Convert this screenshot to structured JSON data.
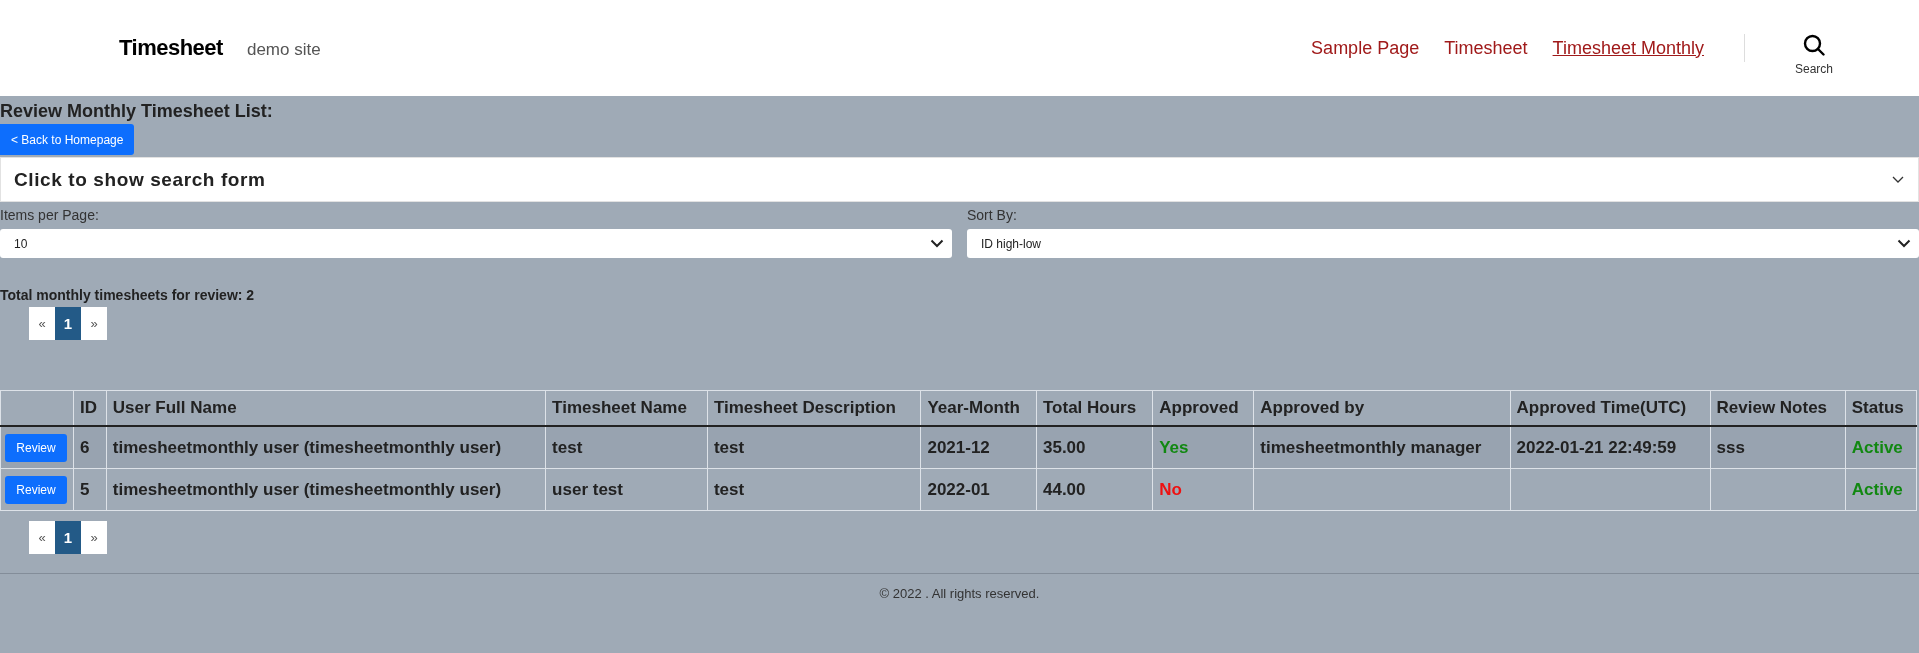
{
  "header": {
    "site_title": "Timesheet",
    "tagline": "demo site",
    "nav": [
      {
        "label": "Sample Page",
        "selected": false
      },
      {
        "label": "Timesheet",
        "selected": false
      },
      {
        "label": "Timesheet Monthly",
        "selected": true
      }
    ],
    "search_label": "Search"
  },
  "page_title": "Review Monthly Timesheet List:",
  "back_button": "< Back to Homepage",
  "search_form_toggle": {
    "label": "Click to show search form",
    "expanded": false
  },
  "items_per_page": {
    "label": "Items per Page:",
    "value": "10"
  },
  "sort_by": {
    "label": "Sort By:",
    "value": "ID high-low"
  },
  "total_text": "Total monthly timesheets for review: 2",
  "pagination_top": {
    "prev": "«",
    "pages": [
      {
        "label": "1",
        "selected": true
      }
    ],
    "next": "»"
  },
  "table": {
    "columns": [
      "ID",
      "User Full Name",
      "Timesheet Name",
      "Timesheet Description",
      "Year-Month",
      "Total Hours",
      "Approved",
      "Approved by",
      "Approved Time(UTC)",
      "Review Notes",
      "Status"
    ],
    "rows": [
      {
        "action": "Review",
        "id": "6",
        "user_full_name": "timesheetmonthly user (timesheetmonthly user)",
        "timesheet_name": "test",
        "timesheet_description": "test",
        "year_month": "2021-12",
        "total_hours": "35.00",
        "approved": "Yes",
        "is_approved": true,
        "approved_by": "timesheetmonthly manager",
        "approved_time": "2022-01-21 22:49:59",
        "review_notes": "sss",
        "status": "Active",
        "active": true
      },
      {
        "action": "Review",
        "id": "5",
        "user_full_name": "timesheetmonthly user (timesheetmonthly user)",
        "timesheet_name": "user test",
        "timesheet_description": "test",
        "year_month": "2022-01",
        "total_hours": "44.00",
        "approved": "No",
        "is_approved": false,
        "approved_by": "",
        "approved_time": "",
        "review_notes": "",
        "status": "Active",
        "active": true
      }
    ]
  },
  "pagination_bottom": {
    "prev": "«",
    "pages": [
      {
        "label": "1",
        "selected": true
      }
    ],
    "next": "»"
  },
  "footer": "© 2022 . All rights reserved."
}
